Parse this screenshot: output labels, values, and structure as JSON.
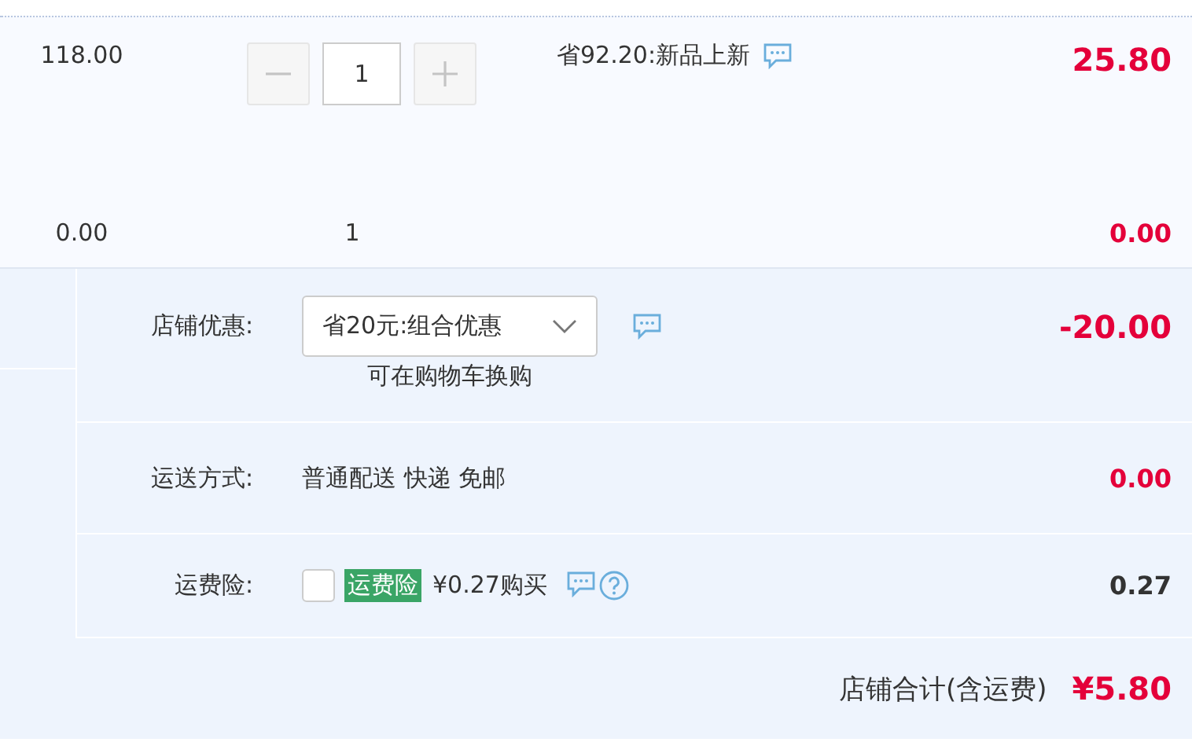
{
  "items": [
    {
      "kind": "stepper",
      "price": "118.00",
      "quantity": "1",
      "promo": "省92.20:新品上新",
      "subtotal": "25.80"
    },
    {
      "kind": "plain",
      "price": "0.00",
      "quantity": "1",
      "subtotal": "0.00"
    }
  ],
  "shop_discount": {
    "label": "店铺优惠:",
    "selected_option": "省20元:组合优惠",
    "note": "可在购物车换购",
    "amount": "-20.00"
  },
  "shipping": {
    "label": "运送方式:",
    "method": "普通配送 快递 免邮",
    "amount": "0.00"
  },
  "insurance": {
    "label": "运费险:",
    "checked": false,
    "tag": "运费险",
    "price": "¥0.27购买",
    "amount": "0.27"
  },
  "total": {
    "label": "店铺合计(含运费)",
    "amount": "¥5.80"
  }
}
